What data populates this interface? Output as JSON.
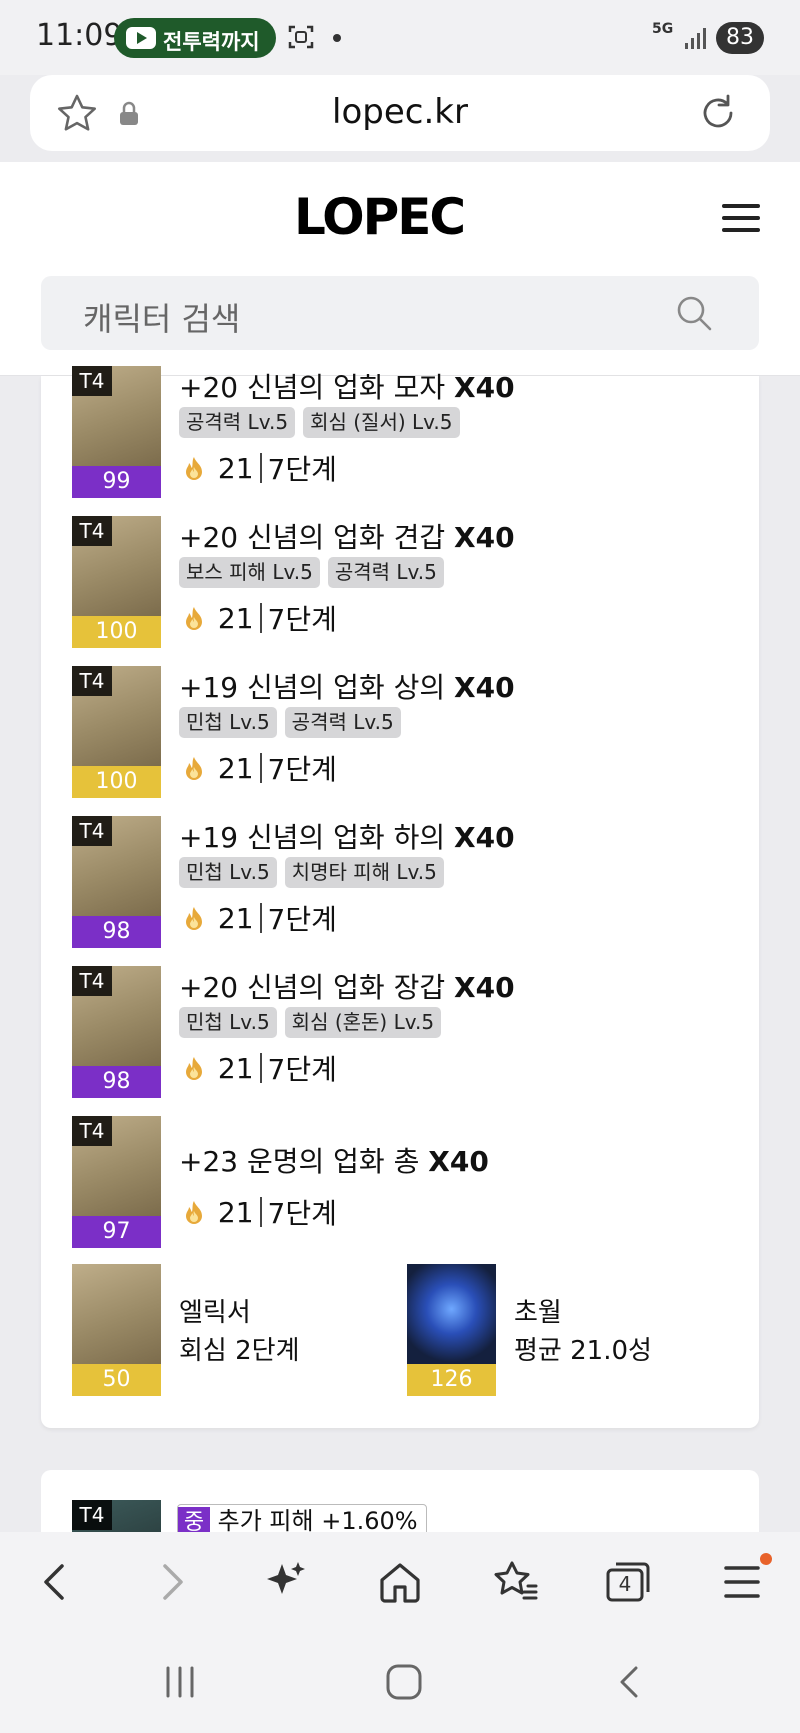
{
  "status": {
    "time": "11:09",
    "pill_text": "전투력까지",
    "network": "5G",
    "battery": "83"
  },
  "browser": {
    "url": "lopec.kr",
    "tab_count": "4"
  },
  "site": {
    "logo": "LOPEC",
    "search_placeholder": "캐릭터 검색"
  },
  "equipment": [
    {
      "tier": "T4",
      "quality": "99",
      "quality_color": "#7b2fc7",
      "name": "+20 신념의 업화 모자",
      "mult": "X40",
      "tags": [
        "공격력 Lv.5",
        "회심 (질서) Lv.5"
      ],
      "stone": "21",
      "stage": "7단계"
    },
    {
      "tier": "T4",
      "quality": "100",
      "quality_color": "#e6c23a",
      "name": "+20 신념의 업화 견갑",
      "mult": "X40",
      "tags": [
        "보스 피해 Lv.5",
        "공격력 Lv.5"
      ],
      "stone": "21",
      "stage": "7단계"
    },
    {
      "tier": "T4",
      "quality": "100",
      "quality_color": "#e6c23a",
      "name": "+19 신념의 업화 상의",
      "mult": "X40",
      "tags": [
        "민첩 Lv.5",
        "공격력 Lv.5"
      ],
      "stone": "21",
      "stage": "7단계"
    },
    {
      "tier": "T4",
      "quality": "98",
      "quality_color": "#7b2fc7",
      "name": "+19 신념의 업화 하의",
      "mult": "X40",
      "tags": [
        "민첩 Lv.5",
        "치명타 피해 Lv.5"
      ],
      "stone": "21",
      "stage": "7단계"
    },
    {
      "tier": "T4",
      "quality": "98",
      "quality_color": "#7b2fc7",
      "name": "+20 신념의 업화 장갑",
      "mult": "X40",
      "tags": [
        "민첩 Lv.5",
        "회심 (혼돈) Lv.5"
      ],
      "stone": "21",
      "stage": "7단계"
    },
    {
      "tier": "T4",
      "quality": "97",
      "quality_color": "#7b2fc7",
      "name": "+23 운명의 업화 총",
      "mult": "X40",
      "tags": [],
      "stone": "21",
      "stage": "7단계"
    }
  ],
  "extras": [
    {
      "quality": "50",
      "title": "엘릭서",
      "detail": "회심 2단계"
    },
    {
      "quality": "126",
      "title": "초월",
      "detail": "평균 21.0성"
    }
  ],
  "next_card": {
    "tier": "T4",
    "badge": "중",
    "text": "추가 피해 +1.60%"
  }
}
